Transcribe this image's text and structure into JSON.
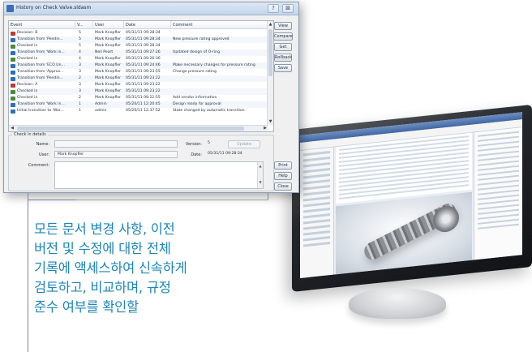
{
  "dialog": {
    "title": "History on Check Valve.sldasm",
    "help_label": "?",
    "close_label": "⊠",
    "columns": {
      "event": "Event",
      "version": "V...",
      "user": "User",
      "date": "Date",
      "comment": "Comment"
    },
    "rows": [
      {
        "event": "Revision: B",
        "version": "5",
        "user": "Mark Knopfler",
        "date": "05/31/11 09:28:34",
        "comment": "",
        "icon": "#c0392b"
      },
      {
        "event": "Transition from 'Pendin...",
        "version": "5",
        "user": "Mark Knopfler",
        "date": "05/31/11 09:28:34",
        "comment": "New pressure rating approved",
        "icon": "#2e6fb8"
      },
      {
        "event": "Checked in",
        "version": "5",
        "user": "Mark Knopfler",
        "date": "05/31/11 09:28:34",
        "comment": "",
        "icon": "#4c8a3a"
      },
      {
        "event": "Transition from 'Work in...",
        "version": "4",
        "user": "Neil Peart",
        "date": "05/31/11 09:27:26",
        "comment": "Updated design of O-ring",
        "icon": "#2e6fb8"
      },
      {
        "event": "Checked in",
        "version": "4",
        "user": "Mark Knopfler",
        "date": "05/31/11 09:26:36",
        "comment": "",
        "icon": "#4c8a3a"
      },
      {
        "event": "Transition from 'ECO Un...",
        "version": "3",
        "user": "Mark Knopfler",
        "date": "05/31/11 09:24:46",
        "comment": "Make necessary changes for pressure rating",
        "icon": "#2e6fb8"
      },
      {
        "event": "Transition from 'Approv...",
        "version": "3",
        "user": "Mark Knopfler",
        "date": "05/31/11 09:23:55",
        "comment": "Change pressure rating",
        "icon": "#2e6fb8"
      },
      {
        "event": "Transition from 'Pendin...",
        "version": "2",
        "user": "Mark Knopfler",
        "date": "05/31/11 09:23:22",
        "comment": "",
        "icon": "#2e6fb8"
      },
      {
        "event": "Revision: A",
        "version": "3",
        "user": "Mark Knopfler",
        "date": "05/31/11 09:23:22",
        "comment": "",
        "icon": "#c0392b"
      },
      {
        "event": "Checked in",
        "version": "3",
        "user": "Mark Knopfler",
        "date": "05/31/11 09:23:22",
        "comment": "",
        "icon": "#4c8a3a"
      },
      {
        "event": "Checked in",
        "version": "2",
        "user": "Mark Knopfler",
        "date": "05/31/11 09:22:55",
        "comment": "Add vendor information",
        "icon": "#4c8a3a"
      },
      {
        "event": "Transition from 'Work in...",
        "version": "1",
        "user": "Admin",
        "date": "05/20/11 12:20:45",
        "comment": "Design ready for approval",
        "icon": "#2e6fb8"
      },
      {
        "event": "Initial transition to 'Wor...",
        "version": "1",
        "user": "admin",
        "date": "05/20/11 12:37:52",
        "comment": "State changed by automatic transition.",
        "icon": "#2e6fb8"
      }
    ],
    "side_buttons": {
      "view": "View",
      "compare": "Compare",
      "get": "Get",
      "rollback": "Rollback",
      "save": "Save"
    },
    "bottom_buttons": {
      "print": "Print",
      "help": "Help",
      "close": "Close"
    },
    "details": {
      "group_label": "Check in details",
      "name_label": "Name:",
      "name_value": "",
      "version_label": "Version:",
      "version_value": "5",
      "update_label": "Update",
      "user_label": "User:",
      "user_value": "Mark Knopfler",
      "date_label": "Date:",
      "date_value": "05/31/11 09:28:34",
      "comment_label": "Comment:",
      "comment_value": ""
    }
  },
  "callout": {
    "lines": [
      "모든 문서 변경 사항, 이전",
      "버전 및 수정에 대한 전체",
      "기록에 액세스하여 신속하게",
      "검토하고, 비교하며, 규정",
      "준수 여부를 확인할"
    ]
  }
}
